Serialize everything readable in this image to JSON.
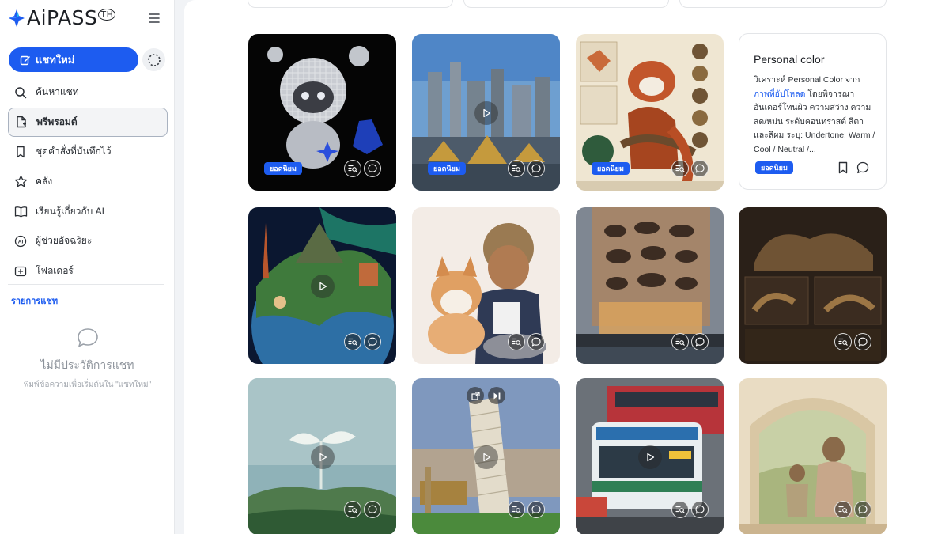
{
  "brand": {
    "name": "AiPASS",
    "mark": "TH",
    "accent": "#1d5cf0"
  },
  "sidebar": {
    "new_chat": "แชทใหม่",
    "items": [
      {
        "label": "ค้นหาแชท",
        "icon": "search-icon"
      },
      {
        "label": "พรีพรอมต์",
        "icon": "prompt-file-icon",
        "active": true
      },
      {
        "label": "ชุดคำสั่งที่บันทึกไว้",
        "icon": "bookmark-icon"
      },
      {
        "label": "คลัง",
        "icon": "star-icon"
      },
      {
        "label": "เรียนรู้เกี่ยวกับ AI",
        "icon": "book-icon"
      },
      {
        "label": "ผู้ช่วยอัจฉริยะ",
        "icon": "ai-assistant-icon"
      },
      {
        "label": "โฟลเดอร์",
        "icon": "folder-plus-icon"
      }
    ],
    "section_title": "รายการแชท",
    "empty_title": "ไม่มีประวัติการแชท",
    "empty_subtitle": "พิมพ์ข้อความเพื่อเริ่มต้นใน \"แชทใหม่\""
  },
  "gallery": {
    "badge_label": "ยอดนิยม",
    "cards": [
      {
        "name": "card-chrome-robot",
        "badge": true
      },
      {
        "name": "card-bangkok-city",
        "badge": true,
        "video": true
      },
      {
        "name": "card-red-panda-infographic",
        "badge": true
      },
      {
        "name": "card-personal-color",
        "badge": true,
        "text": true
      },
      {
        "name": "card-world-landmarks",
        "video": true
      },
      {
        "name": "card-boy-shiba"
      },
      {
        "name": "card-organic-building"
      },
      {
        "name": "card-leopard-furniture"
      },
      {
        "name": "card-sprout",
        "video": true
      },
      {
        "name": "card-pisa-tower",
        "video": true
      },
      {
        "name": "card-bangkok-buses",
        "video": true
      },
      {
        "name": "card-family-paper-art"
      }
    ],
    "personal_color": {
      "title": "Personal color",
      "body_before": "วิเคราะห์ Personal Color จาก ",
      "body_link": "ภาพที่อัปโหลด",
      "body_after": " โดยพิจารณาอันเดอร์โทนผิว ความสว่าง ความสด/หม่น ระดับคอนทราสต์ สีตา และสีผม ระบุ: Undertone: Warm / Cool / Neutral /..."
    }
  }
}
